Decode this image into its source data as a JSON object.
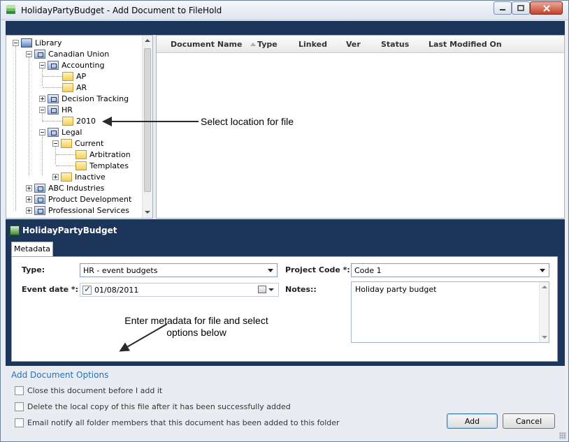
{
  "window": {
    "title": "HolidayPartyBudget - Add Document to FileHold",
    "icon": "filehold-app-icon"
  },
  "tree": {
    "root": "Library",
    "nodes": [
      {
        "label": "Canadian Union"
      },
      {
        "label": "Accounting"
      },
      {
        "label": "AP"
      },
      {
        "label": "AR"
      },
      {
        "label": "Decision Tracking"
      },
      {
        "label": "HR"
      },
      {
        "label": "2010"
      },
      {
        "label": "Legal"
      },
      {
        "label": "Current"
      },
      {
        "label": "Arbitration"
      },
      {
        "label": "Templates"
      },
      {
        "label": "Inactive"
      },
      {
        "label": "ABC Industries"
      },
      {
        "label": "Product Development"
      },
      {
        "label": "Professional Services"
      }
    ]
  },
  "doclist": {
    "columns": [
      "Document Name",
      "Type",
      "Linked",
      "Ver",
      "Status",
      "Last Modified On"
    ]
  },
  "annotations": {
    "select_location": "Select location for file",
    "enter_metadata": "Enter metadata for file and select options below"
  },
  "document": {
    "title": "HolidayPartyBudget"
  },
  "tabs": [
    "Metadata"
  ],
  "metadata": {
    "type_label": "Type:",
    "type_value": "HR - event budgets",
    "project_label": "Project Code *:",
    "project_value": "Code 1",
    "event_label": "Event date *:",
    "event_value": "01/08/2011",
    "notes_label": "Notes::",
    "notes_value": "Holiday party budget"
  },
  "options": {
    "title": "Add Document Options",
    "items": [
      "Close this document before I add it",
      "Delete the local copy of this file after it has been successfully added",
      "Email notify all folder members that this document has been added to this folder"
    ]
  },
  "buttons": {
    "add": "Add",
    "cancel": "Cancel"
  },
  "colors": {
    "header_navy": "#1c3559",
    "link_blue": "#2a6fb6",
    "window_bg": "#e9edf2"
  }
}
